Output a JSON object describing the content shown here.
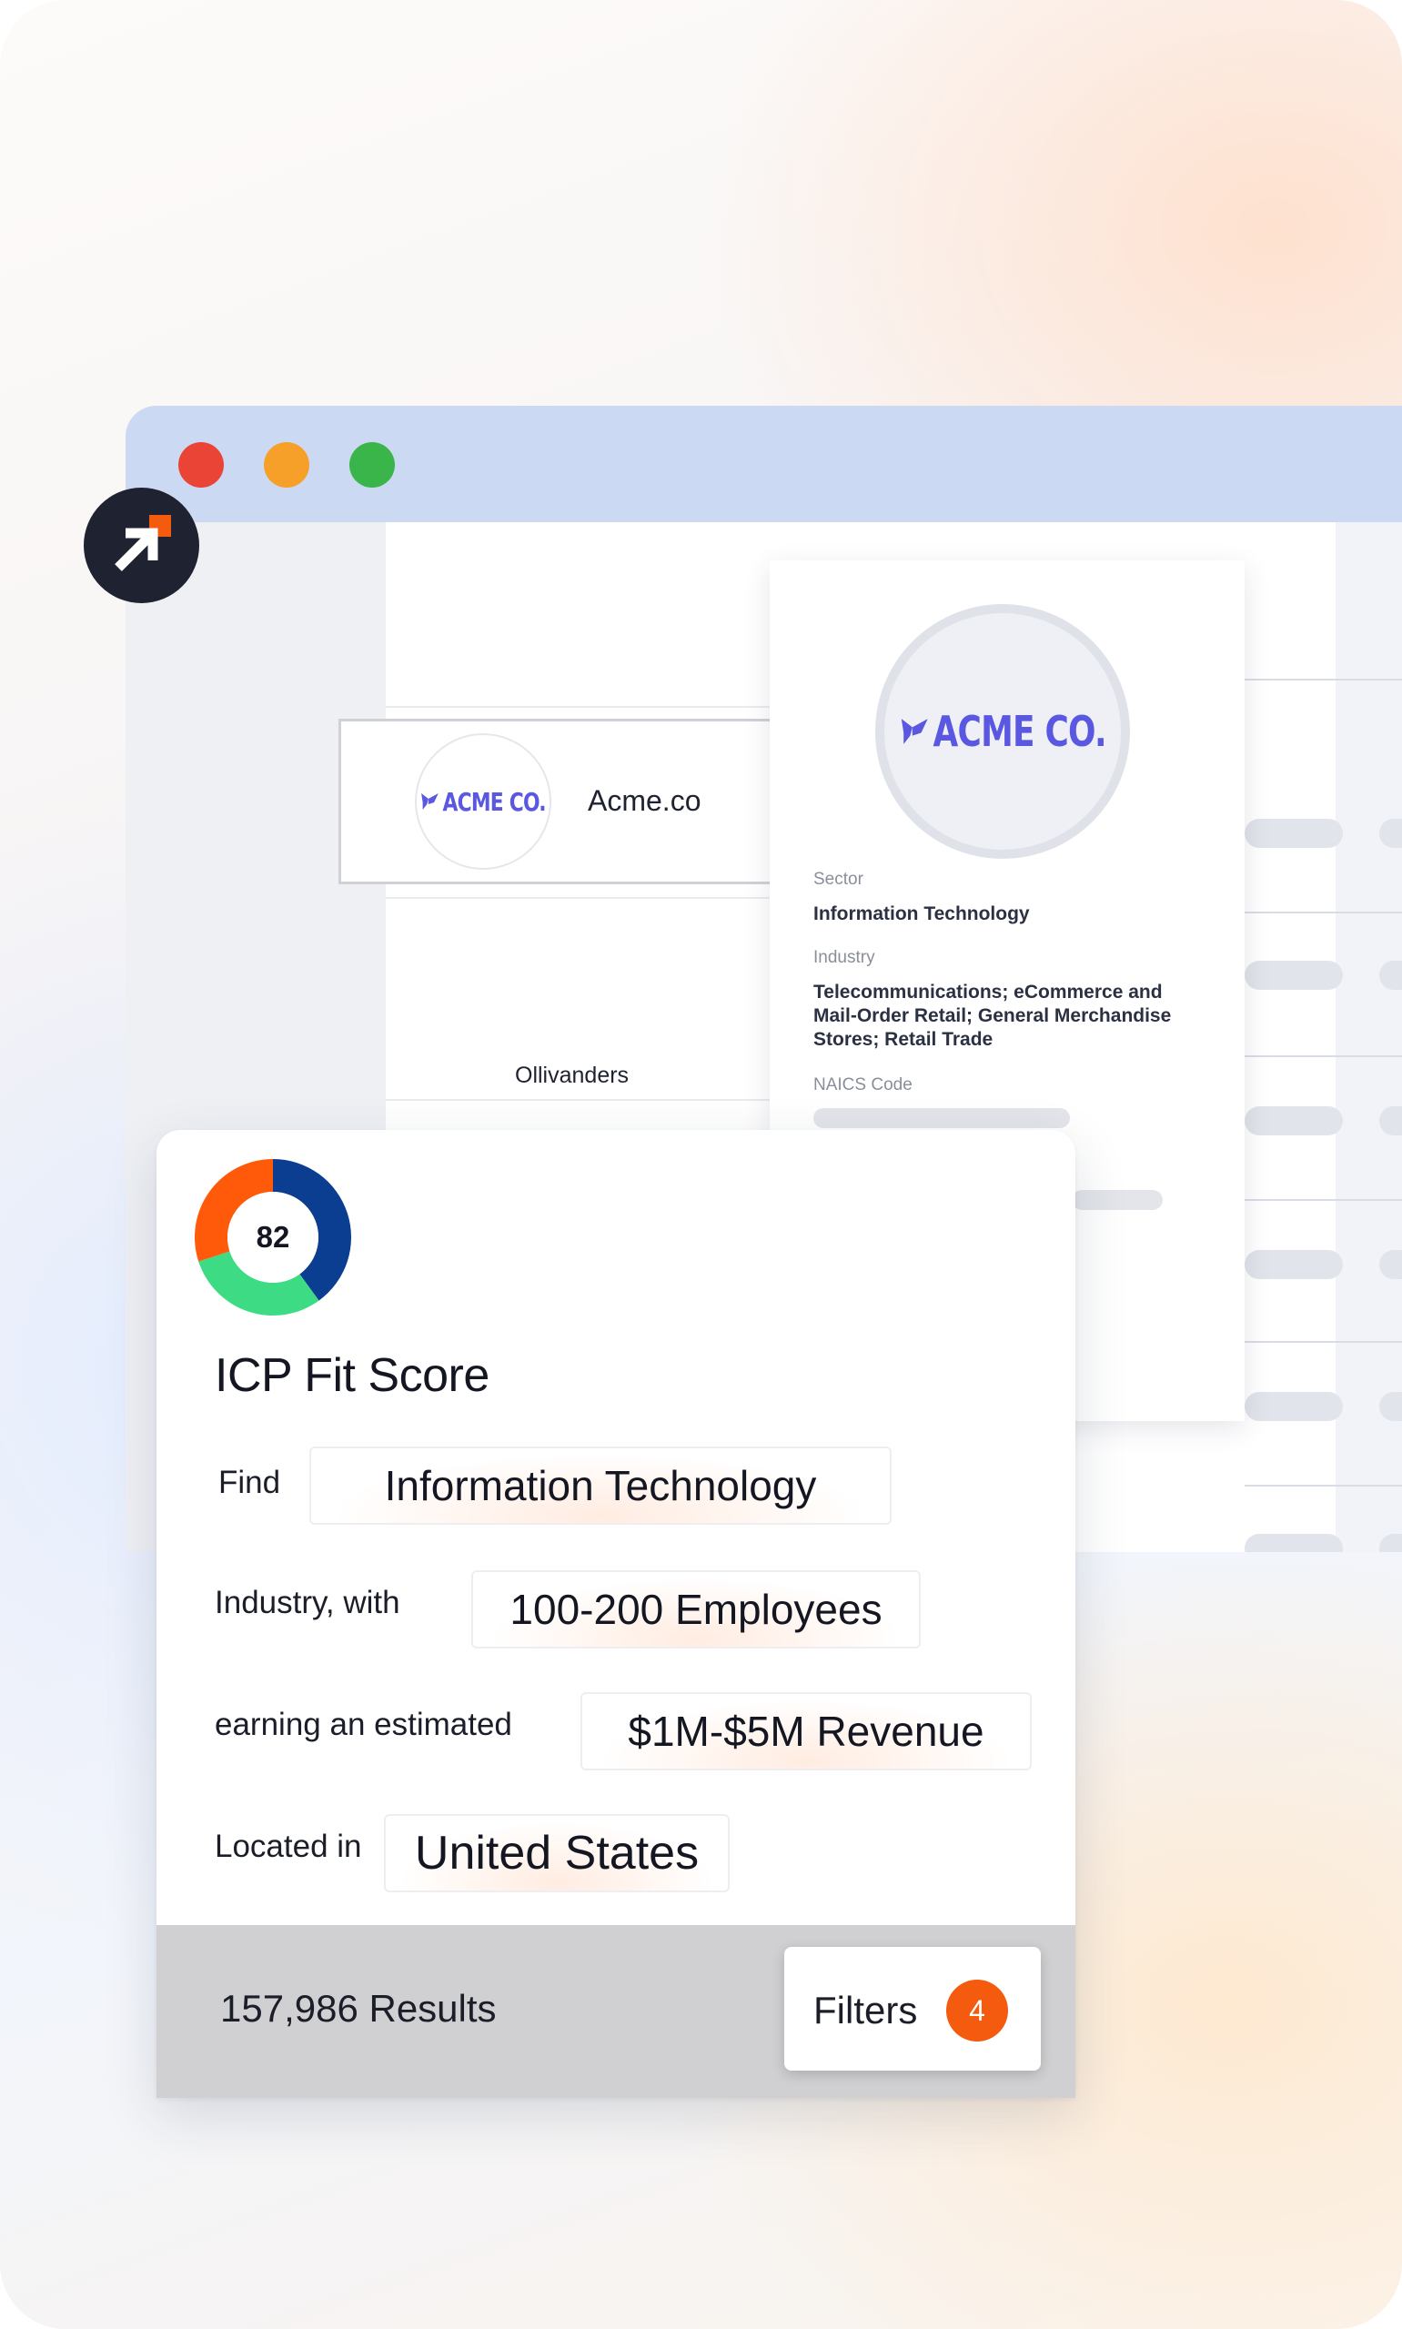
{
  "window": {
    "traffic_lights": [
      "close",
      "minimize",
      "zoom"
    ],
    "colors": {
      "close": "#ea4437",
      "minimize": "#f6a02a",
      "zoom": "#3ab54a",
      "titlebar": "#ccd9f3"
    }
  },
  "sidebar": {
    "logo_icon": "arrow-up-right-icon",
    "logo_colors": {
      "background": "#1f2230",
      "accent": "#f45b0e"
    }
  },
  "list": {
    "rows": [
      {
        "name": "Acme.co",
        "logo_text": "ACME CO."
      },
      {
        "name": "Ollivanders"
      }
    ]
  },
  "company_detail": {
    "logo_text": "ACME CO.",
    "logo_color": "#5a57e0",
    "fields": [
      {
        "label": "Sector",
        "value": "Information Technology"
      },
      {
        "label": "Industry",
        "value": "Telecommunications; eCommerce and Mail-Order Retail; General Merchandise Stores; Retail Trade"
      },
      {
        "label": "NAICS Code",
        "value": ""
      }
    ]
  },
  "icp": {
    "score": "82",
    "score_segments": [
      {
        "name": "navy",
        "fraction": 0.4,
        "color": "#0b3d91"
      },
      {
        "name": "green",
        "fraction": 0.3,
        "color": "#3ddc84"
      },
      {
        "name": "orange",
        "fraction": 0.3,
        "color": "#ff5a0a"
      }
    ],
    "title": "ICP Fit Score",
    "filters": [
      {
        "prefix": "Find",
        "value": "Information Technology"
      },
      {
        "prefix": "Industry, with",
        "value": "100-200 Employees"
      },
      {
        "prefix": "earning an estimated",
        "value": "$1M-$5M Revenue"
      },
      {
        "prefix": "Located in",
        "value": "United States"
      }
    ],
    "results_label": "157,986 Results",
    "filters_button_label": "Filters",
    "filters_count": "4",
    "accent_color": "#f45b0e"
  }
}
